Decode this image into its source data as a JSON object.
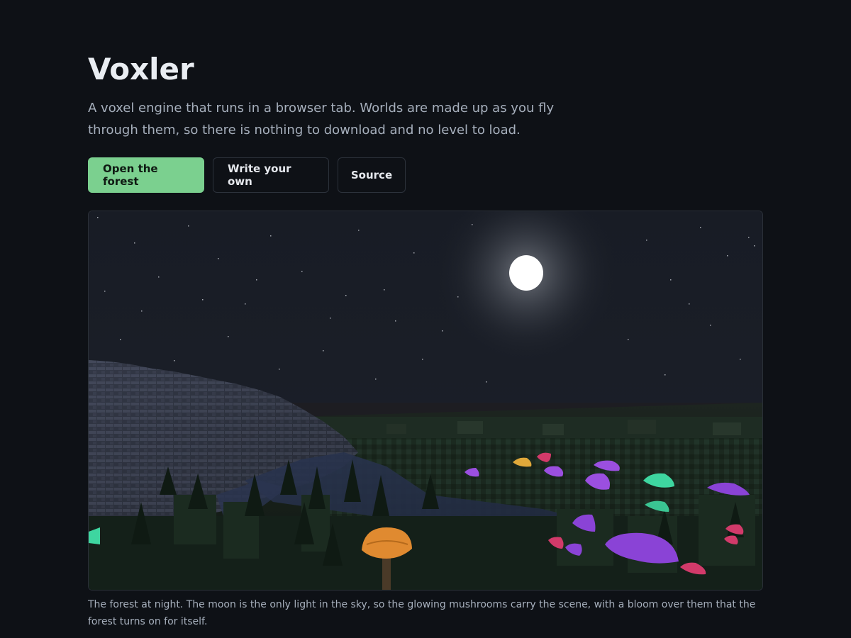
{
  "hero": {
    "title": "Voxler",
    "lede": "A voxel engine that runs in a browser tab. Worlds are made up as you fly through them, so there is nothing to download and no level to load."
  },
  "actions": {
    "primary_label": "Open the forest",
    "write_label": "Write your own",
    "source_label": "Source"
  },
  "figure": {
    "alt": "The forest at night",
    "caption": "The forest at night. The moon is the only light in the sky, so the glowing mushrooms carry the scene, with a bloom over them that the forest turns on for itself."
  },
  "colors": {
    "background": "#0e1116",
    "accent": "#7bd08f",
    "text": "#e6e9ee",
    "muted": "#a6afbc",
    "border": "#2c323b"
  }
}
